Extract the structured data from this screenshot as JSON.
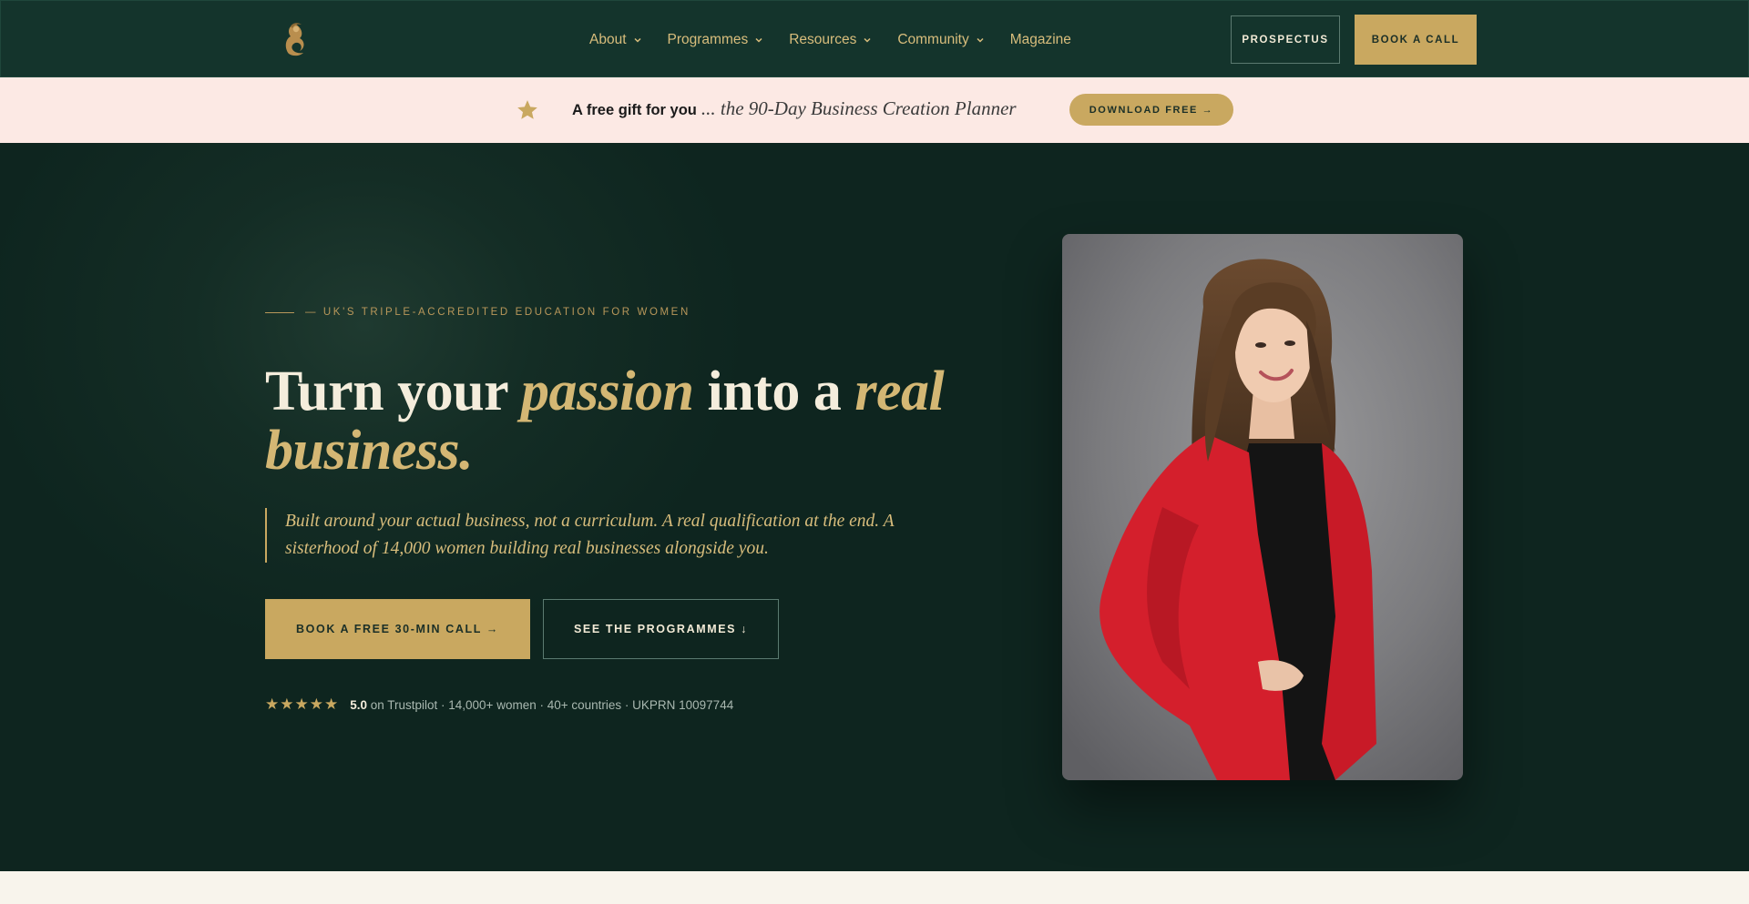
{
  "nav": {
    "logo_icon": "mermaid-logo-icon",
    "menu": [
      {
        "label": "About",
        "dropdown": true
      },
      {
        "label": "Programmes",
        "dropdown": true
      },
      {
        "label": "Resources",
        "dropdown": true
      },
      {
        "label": "Community",
        "dropdown": true
      },
      {
        "label": "Magazine",
        "dropdown": false
      }
    ],
    "prospectus_label": "PROSPECTUS",
    "book_call_label": "BOOK A CALL"
  },
  "promo": {
    "icon": "star-icon",
    "bold_text": "A free gift for you",
    "italic_text": "... the 90-Day Business Creation Planner",
    "download_label": "DOWNLOAD FREE →"
  },
  "hero": {
    "eyebrow": "— UK'S TRIPLE-ACCREDITED EDUCATION FOR WOMEN",
    "headline": {
      "part1": "Turn your ",
      "accent1": "passion",
      "part2": " into a ",
      "accent2": "real business."
    },
    "quote": "Built around your actual business, not a curriculum. A real qualification at the end. A sisterhood of 14,000 women building real businesses alongside you.",
    "primary_cta": "BOOK A FREE 30-MIN CALL →",
    "secondary_cta": "SEE THE PROGRAMMES ↓",
    "rating": {
      "stars": "★★★★★",
      "score": "5.0",
      "text": " on Trustpilot · 14,000+ women · 40+ countries · UKPRN 10097744"
    },
    "portrait_alt": "woman-in-red-blazer-portrait"
  },
  "colors": {
    "nav_bg": "#14342c",
    "hero_bg": "#0e251f",
    "gold": "#c9a860",
    "promo_bg": "#fce9e4",
    "cream": "#f8f4ec"
  }
}
